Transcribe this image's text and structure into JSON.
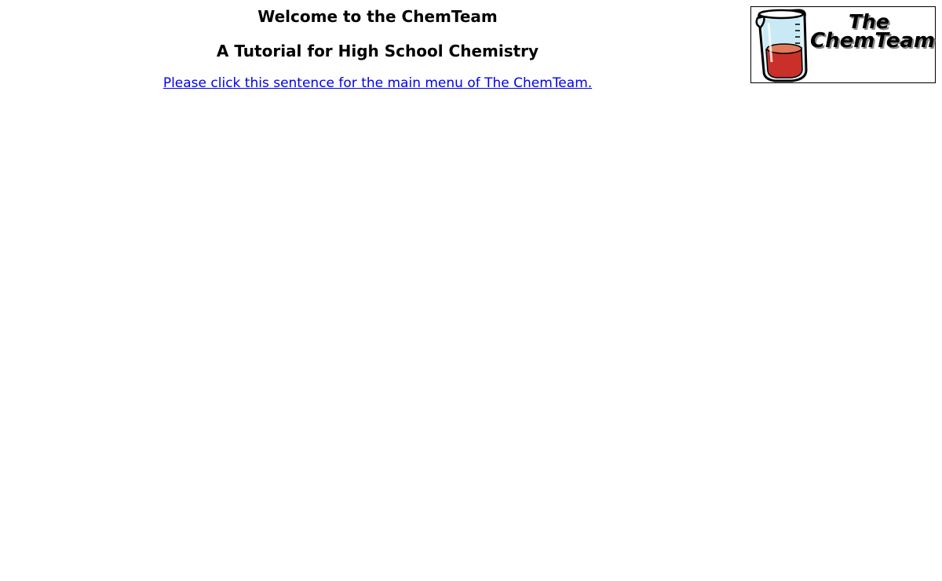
{
  "header": {
    "welcome": "Welcome to the ChemTeam",
    "subtitle": "A Tutorial for High School Chemistry"
  },
  "main": {
    "menu_link": "Please click this sentence for the main menu of The ChemTeam."
  },
  "logo": {
    "line1": "The",
    "line2": "ChemTeam",
    "icon": "beaker-icon"
  },
  "colors": {
    "link": "#0000ee",
    "liquid": "#c9302a",
    "liquid_top": "#e07a5a",
    "glass": "#bfe6f2"
  }
}
